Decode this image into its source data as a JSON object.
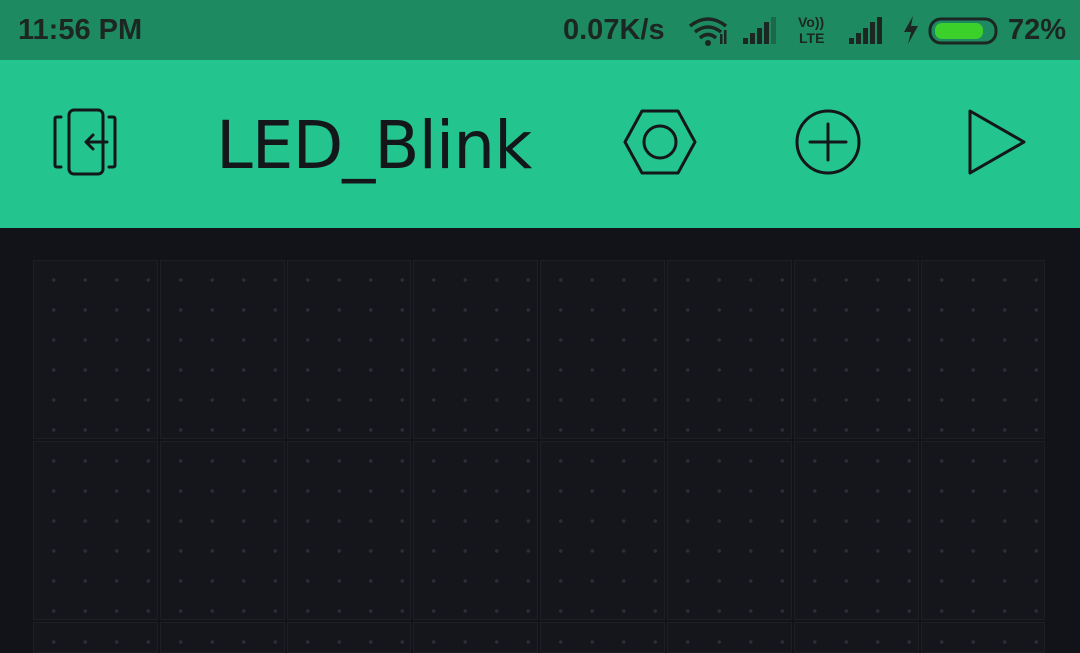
{
  "status_bar": {
    "time": "11:56 PM",
    "network_speed": "0.07K/s",
    "volte_label_top": "Vo))",
    "volte_label_bottom": "LTE",
    "battery_percent": "72%",
    "battery_level": 0.72,
    "icons": [
      "wifi-icon",
      "signal-icon",
      "volte-icon",
      "signal-icon",
      "charging-icon",
      "battery-icon"
    ]
  },
  "app_bar": {
    "title": "LED_Blink",
    "buttons": [
      "exit-icon",
      "settings-hex-icon",
      "add-widget-icon",
      "play-icon"
    ]
  },
  "colors": {
    "status_bar_bg": "#1e8a62",
    "app_bar_bg": "#23c48e",
    "canvas_bg": "#121318",
    "icon_stroke": "#13171a",
    "battery_fill": "#3bd12a"
  },
  "canvas": {
    "grid_columns": 8,
    "grid_rows_visible": 3
  }
}
